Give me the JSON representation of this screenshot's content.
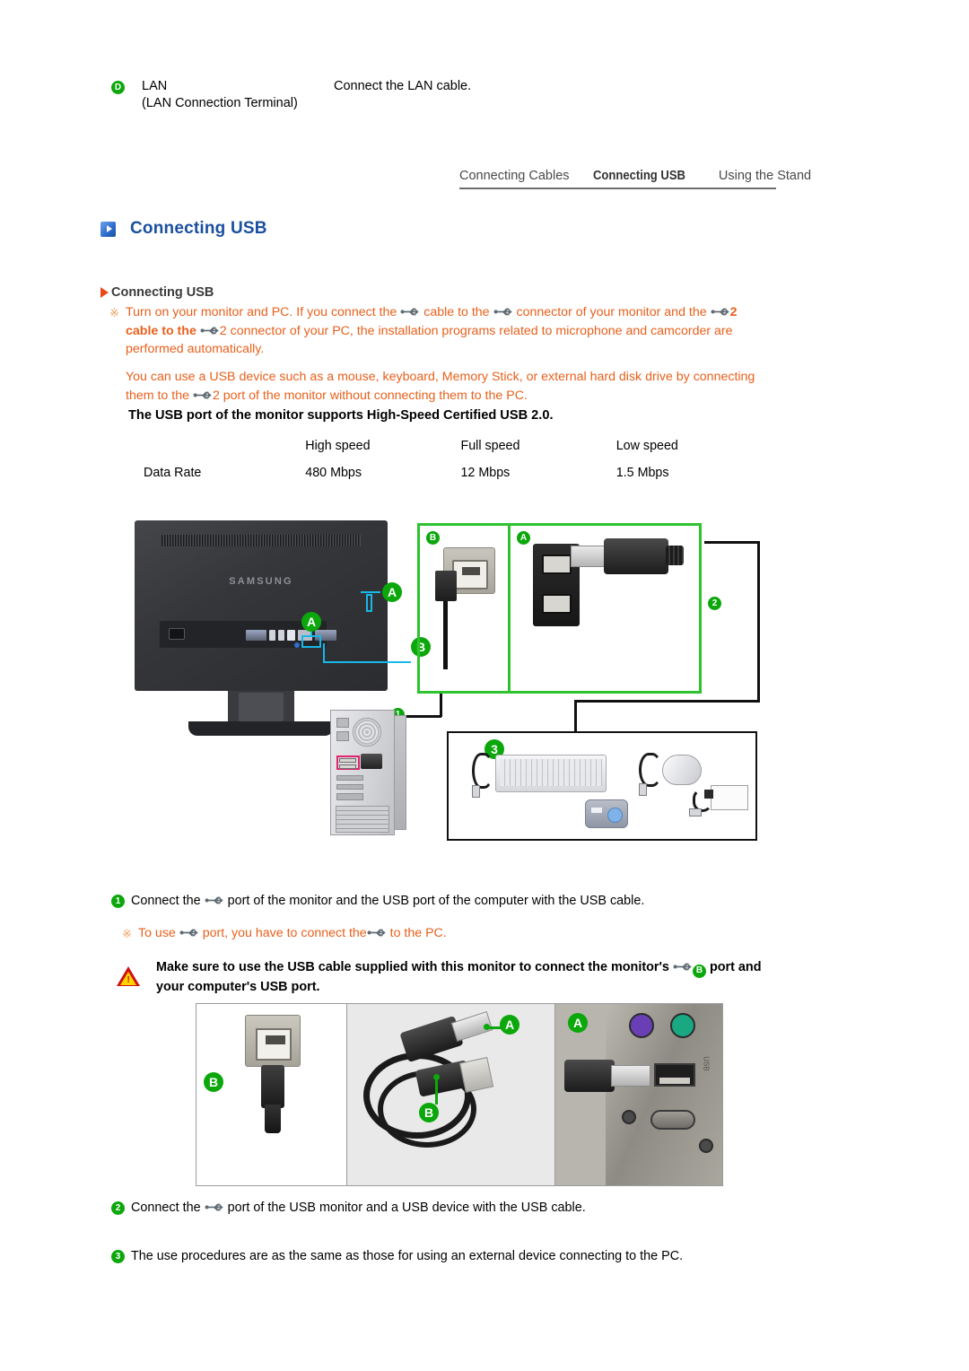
{
  "lan_row": {
    "badge": "D",
    "name": "LAN",
    "sub": "(LAN Connection Terminal)",
    "description": "Connect the LAN cable."
  },
  "tabs": [
    {
      "label": "Connecting Cables",
      "active": false
    },
    {
      "label": "Connecting USB",
      "active": true
    },
    {
      "label": "Using the Stand",
      "active": false
    }
  ],
  "section": {
    "title": "Connecting USB",
    "title_color": "#1a4fa0",
    "sub_title": "Connecting USB"
  },
  "notes": {
    "star": "※",
    "note1_a": "Turn on your monitor and PC. If you connect the",
    "note1_b": "cable to the",
    "note1_c": "connector of your monitor and the",
    "note1_d": "2 cable to the",
    "note1_e": "2 connector of your PC, the installation programs related to microphone and camcorder are performed automatically.",
    "note2_a": "You can use a USB device such as a mouse, keyboard, Memory Stick, or external hard disk drive by connecting them to the",
    "note2_b": "2 port of the monitor without connecting them to the PC.",
    "note3_a": "To use",
    "note3_b": "port, you have to connect the",
    "note3_c": "to the PC."
  },
  "usb20_line": "The USB port of the monitor supports High-Speed Certified USB 2.0.",
  "rate_table": {
    "headers": [
      "",
      "High speed",
      "Full speed",
      "Low speed"
    ],
    "rows": [
      {
        "label": "Data Rate",
        "values": [
          "480 Mbps",
          "12 Mbps",
          "1.5 Mbps"
        ]
      }
    ]
  },
  "diagram": {
    "monitor_brand": "SAMSUNG",
    "badge_a_side": "A",
    "badge_a_port": "A",
    "badge_b_port": "B",
    "panel_label_b": "B",
    "panel_label_a": "A",
    "step_badge_1": "1",
    "step_badge_2": "2",
    "step_badge_3": "3"
  },
  "steps": {
    "step1_n": "1",
    "step1_a": "Connect the",
    "step1_b": "port of the monitor and the USB port of the computer with the USB cable.",
    "step2_n": "2",
    "step2_a": "Connect the",
    "step2_b": "port of the USB monitor and a USB device with the USB cable.",
    "step3_n": "3",
    "step3_text": "The use procedures are as the same as those for using an external device connecting to the PC."
  },
  "warning": {
    "mark": "!",
    "text_a": "Make sure to use the USB cable supplied with this monitor to connect the monitor's",
    "badge": "B",
    "text_b": "port and your computer's USB port."
  },
  "photos": {
    "photo1_label_b": "B",
    "photo2_label_a": "A",
    "photo2_label_b": "B",
    "photo3_label_a": "A",
    "photo3_port_text": "USB"
  },
  "colors": {
    "heading_blue": "#1a4fa0",
    "note_orange": "#e8601c",
    "green_badge": "#0ba70b",
    "panel_green": "#2fc22f",
    "callout_cyan": "#17b8e8",
    "warn_red": "#cf1111",
    "warn_yellow": "#ffd400",
    "pc_usb_highlight": "#e0246e"
  }
}
